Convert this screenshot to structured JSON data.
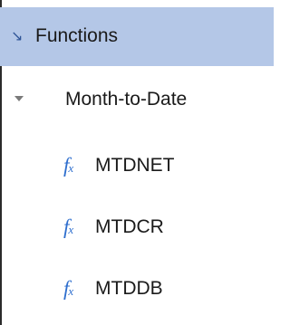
{
  "tree": {
    "root": {
      "label": "Functions",
      "expanded_icon": "collapse-arrow-icon"
    },
    "group": {
      "label": "Month-to-Date",
      "expanded_icon": "caret-down-icon"
    },
    "functions": [
      {
        "label": "MTDNET",
        "icon": "function-icon"
      },
      {
        "label": "MTDCR",
        "icon": "function-icon"
      },
      {
        "label": "MTDDB",
        "icon": "function-icon"
      }
    ]
  },
  "colors": {
    "selection_bg": "#b4c7e7",
    "icon_blue": "#2f6fce",
    "arrow_blue": "#2f5597",
    "caret_gray": "#7a7a7a"
  }
}
